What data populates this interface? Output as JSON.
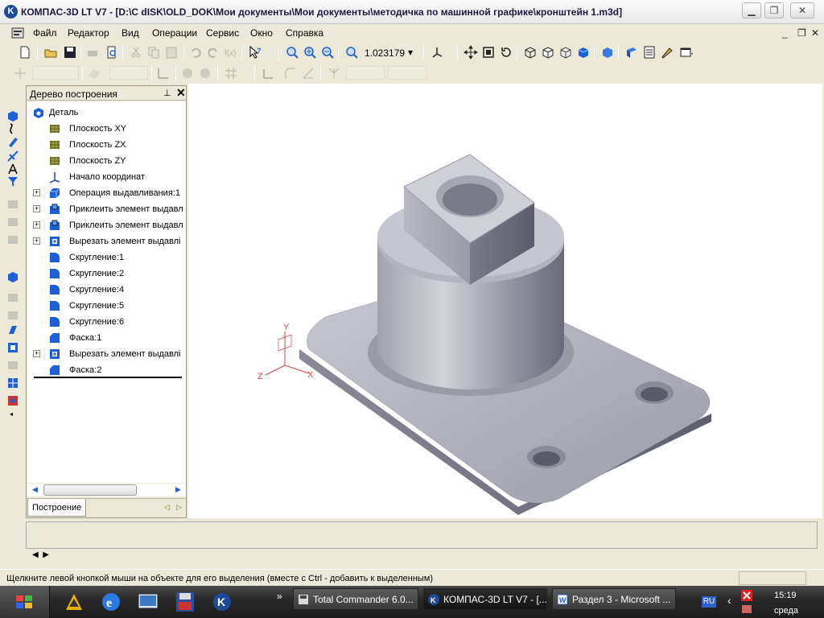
{
  "window": {
    "title": "КОМПАС-3D LT V7 - [D:\\C dISK\\OLD_DOK\\Мои документы\\Мои документы\\методичка по машинной графике\\кронштейн 1.m3d]",
    "logo_letter": "K"
  },
  "menu": {
    "items": [
      "Файл",
      "Редактор",
      "Вид",
      "Операции",
      "Сервис",
      "Окно",
      "Справка"
    ],
    "mdi_minimize": "_",
    "mdi_restore": "❐",
    "mdi_close": "✕"
  },
  "toolbar": {
    "zoom_value": "1.023179",
    "zoom_dropdown": "▾"
  },
  "tree_panel": {
    "title": "Дерево построения",
    "pin": "⊥",
    "close": "✕",
    "root": "Деталь",
    "items": [
      {
        "label": "Плоскость XY",
        "icon": "plane-icon",
        "expandable": false
      },
      {
        "label": "Плоскость ZX",
        "icon": "plane-icon",
        "expandable": false
      },
      {
        "label": "Плоскость ZY",
        "icon": "plane-icon",
        "expandable": false
      },
      {
        "label": "Начало координат",
        "icon": "origin-icon",
        "expandable": false
      },
      {
        "label": "Операция выдавливания:1",
        "icon": "extrude-icon",
        "expandable": true
      },
      {
        "label": "Приклеить элемент выдавл",
        "icon": "boss-icon",
        "expandable": true
      },
      {
        "label": "Приклеить элемент выдавл",
        "icon": "boss-icon",
        "expandable": true
      },
      {
        "label": "Вырезать элемент выдавлі",
        "icon": "cut-icon",
        "expandable": true
      },
      {
        "label": "Скругление:1",
        "icon": "fillet-icon",
        "expandable": false
      },
      {
        "label": "Скругление:2",
        "icon": "fillet-icon",
        "expandable": false
      },
      {
        "label": "Скругление:4",
        "icon": "fillet-icon",
        "expandable": false
      },
      {
        "label": "Скругление:5",
        "icon": "fillet-icon",
        "expandable": false
      },
      {
        "label": "Скругление:6",
        "icon": "fillet-icon",
        "expandable": false
      },
      {
        "label": "Фаска:1",
        "icon": "chamfer-icon",
        "expandable": false
      },
      {
        "label": "Вырезать элемент выдавлі",
        "icon": "cut-icon",
        "expandable": true
      },
      {
        "label": "Фаска:2",
        "icon": "chamfer-icon",
        "expandable": false
      }
    ],
    "expander_symbol": "+",
    "tab": "Построение"
  },
  "axes": {
    "x": "X",
    "y": "Y",
    "z": "Z"
  },
  "status": {
    "hint": "Щелкните левой кнопкой мыши на объекте для его выделения (вместе с Ctrl - добавить к выделенным)"
  },
  "taskbar": {
    "more": "»",
    "tasks": [
      "Total Commander 6.0...",
      "КОМПАС-3D LT V7 - [...",
      "Раздел 3 - Microsoft ..."
    ],
    "lang": "RU",
    "chevron": "‹",
    "time": "15:19",
    "day": "среда"
  },
  "colors": {
    "accent_blue": "#1f5fd6",
    "plane_olive": "#6b6b1e",
    "part_gray": "#8a8a96",
    "axis_red": "#e04040"
  }
}
